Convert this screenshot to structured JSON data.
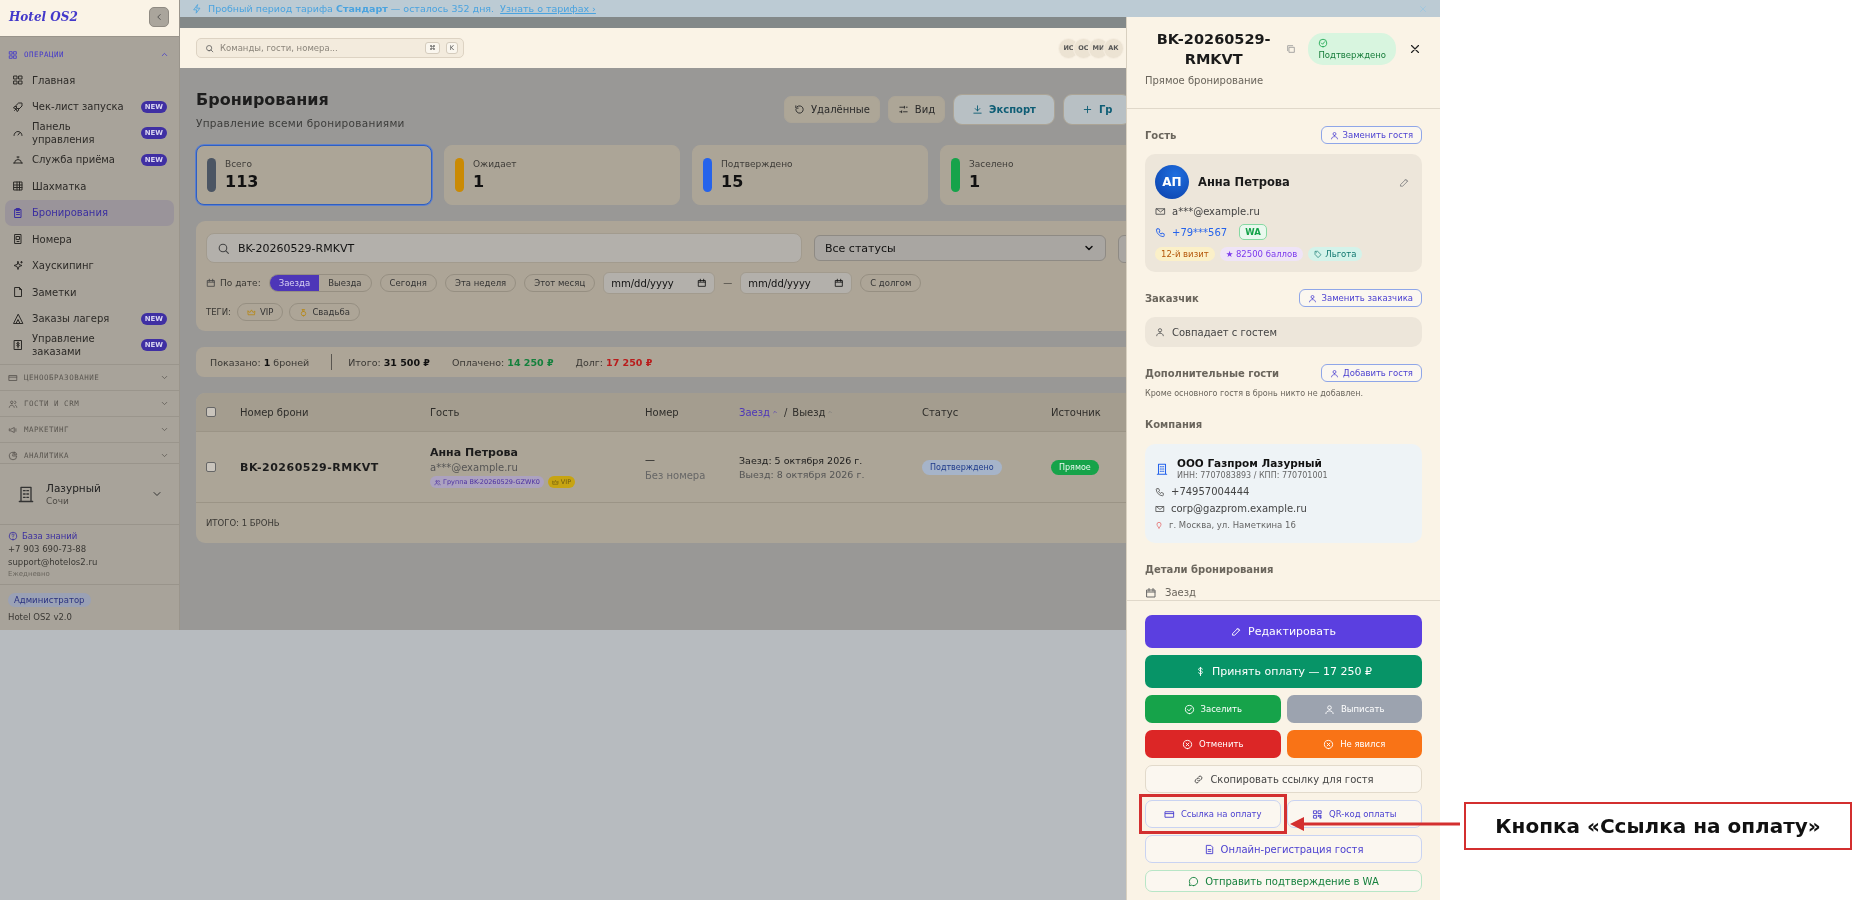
{
  "banner": {
    "text": "Пробный период тарифа **Стандарт** — осталось 352 дня.",
    "link": "Узнать о тарифах ›"
  },
  "sidebar": {
    "logo": "Hotel OS2",
    "sections": [
      {
        "title": "ОПЕРАЦИИ",
        "expanded": true,
        "items": [
          {
            "label": "Главная",
            "selected": false
          },
          {
            "label": "Чек-лист запуска",
            "badge": "NEW",
            "selected": false
          },
          {
            "label": "Панель управления",
            "badge": "NEW",
            "selected": false
          },
          {
            "label": "Служба приёма",
            "badge": "NEW",
            "selected": false
          },
          {
            "label": "Шахматка",
            "selected": false
          },
          {
            "label": "Бронирования",
            "selected": true
          },
          {
            "label": "Номера",
            "selected": false
          },
          {
            "label": "Хаускипинг",
            "selected": false
          },
          {
            "label": "Заметки",
            "selected": false
          },
          {
            "label": "Заказы лагеря",
            "badge": "NEW",
            "selected": false
          },
          {
            "label": "Управление заказами",
            "badge": "NEW",
            "selected": false
          }
        ]
      },
      {
        "title": "ЦЕНООБРАЗОВАНИЕ",
        "expanded": false
      },
      {
        "title": "ГОСТИ И CRM",
        "expanded": false
      },
      {
        "title": "МАРКЕТИНГ",
        "expanded": false
      },
      {
        "title": "АНАЛИТИКА",
        "expanded": false
      }
    ],
    "hotel": {
      "name": "Лазурный",
      "city": "Сочи"
    },
    "support": {
      "link": "База знаний",
      "phone": "+7 903 690-73-88",
      "email": "support@hotelos2.ru",
      "hours": "Ежедневно"
    },
    "user": {
      "role": "Администратор",
      "version": "Hotel OS2 v2.0"
    }
  },
  "topbar": {
    "search_placeholder": "Команды, гости, номера...",
    "shortcut": [
      "⌘",
      "K"
    ],
    "avatars": [
      "ИС",
      "ОС",
      "МИ",
      "АК"
    ]
  },
  "page": {
    "title": "Бронирования",
    "subtitle": "Управление всеми бронированиями",
    "actions": [
      {
        "label": "Удалённые",
        "kind": "restore"
      },
      {
        "label": "Вид",
        "kind": "view"
      },
      {
        "label": "Экспорт",
        "kind": "export"
      },
      {
        "label": "Гр",
        "kind": "create"
      }
    ]
  },
  "stats": [
    {
      "label": "Всего",
      "value": "113",
      "color": "#4b5563",
      "selected": true
    },
    {
      "label": "Ожидает",
      "value": "1",
      "color": "#ca8a04",
      "selected": false
    },
    {
      "label": "Подтверждено",
      "value": "15",
      "color": "#2563eb",
      "selected": false
    },
    {
      "label": "Заселено",
      "value": "1",
      "color": "#16a34a",
      "selected": false
    }
  ],
  "filters": {
    "search": "BK-20260529-RMKVT",
    "status": "Все статусы",
    "date_label": "По дате:",
    "date_modes": [
      {
        "label": "Заезда",
        "selected": true
      },
      {
        "label": "Выезда",
        "selected": false
      }
    ],
    "presets": [
      "Сегодня",
      "Эта неделя",
      "Этот месяц"
    ],
    "date_from": "mm/dd/yyyy",
    "range_separator": "—",
    "date_to": "mm/dd/yyyy",
    "debt": "С долгом",
    "tags_label": "ТЕГИ:",
    "tags": [
      {
        "label": "VIP",
        "kind": "vip"
      },
      {
        "label": "Свадьба",
        "kind": "wedding"
      }
    ]
  },
  "summary": [
    {
      "text": "Показано: **1** броней",
      "kind": "shown"
    },
    {
      "text": "Итого: **31 500 ₽**",
      "kind": "total"
    },
    {
      "text": "Оплачено: **14 250 ₽**",
      "kind": "paid"
    },
    {
      "text": "Долг: **17 250 ₽**",
      "kind": "debt"
    }
  ],
  "table": {
    "select_all_checked": false,
    "columns": [
      {
        "label": "Номер брони"
      },
      {
        "label": "Гость"
      },
      {
        "label": "Номер"
      },
      {
        "kind": "sort_pair",
        "separator": "/",
        "parts": [
          {
            "label": "Заезд",
            "selected": true
          },
          {
            "label": "Выезд",
            "selected": false
          }
        ]
      },
      {
        "label": "Статус"
      },
      {
        "label": "Источник"
      }
    ],
    "rows": [
      {
        "checked": false,
        "number": "BK-20260529-RMKVT",
        "guest": "Анна Петрова",
        "email": "a***@example.ru",
        "tags": [
          {
            "label": "Группа BK-20260529-GZWK0",
            "kind": "group"
          },
          {
            "label": "VIP",
            "kind": "vip"
          }
        ],
        "room": "—",
        "room_note": "Без номера",
        "checkin": "Заезд: 5 октября 2026 г.",
        "checkout": "Выезд: 8 октября 2026 г.",
        "status": "Подтверждено",
        "source": "Прямое"
      }
    ],
    "footer": "ИТОГО: 1 БРОНЬ"
  },
  "drawer": {
    "title": "BK-20260529-RMKVT",
    "status": "Подтверждено",
    "subtitle": "Прямое бронирование",
    "guest_section": {
      "title": "Гость",
      "action": "Заменить гостя"
    },
    "guest": {
      "initials": "АП",
      "name": "Анна Петрова",
      "email": "a***@example.ru",
      "phone": "+79***567",
      "messenger": "WA",
      "tags": [
        {
          "label": "12-й визит",
          "kind": "visits"
        },
        {
          "label": "★ 82500 баллов",
          "kind": "points"
        },
        {
          "label": "Льгота",
          "kind": "benefit"
        }
      ]
    },
    "customer_section": {
      "title": "Заказчик",
      "action": "Заменить заказчика",
      "value": "Совпадает с гостем"
    },
    "extra_section": {
      "title": "Дополнительные гости",
      "action": "Добавить гостя",
      "note": "Кроме основного гостя в бронь никто не добавлен."
    },
    "company_section": {
      "title": "Компания",
      "name": "ООО Газпром Лазурный",
      "ids": "ИНН: 7707083893 / КПП: 770701001",
      "phone": "+74957004444",
      "email": "corp@gazprom.example.ru",
      "address": "г. Москва, ул. Наметкина 16"
    },
    "details_section": {
      "title": "Детали бронирования",
      "first_label": "Заезд"
    },
    "actions": [
      {
        "label": "Редактировать",
        "kind": "edit",
        "highlighted": false
      },
      {
        "label": "Принять оплату — 17 250 ₽",
        "kind": "pay",
        "highlighted": false
      },
      {
        "label": "Заселить",
        "kind": "checkin",
        "highlighted": false
      },
      {
        "label": "Выписать",
        "kind": "checkout",
        "highlighted": false
      },
      {
        "label": "Отменить",
        "kind": "cancel",
        "highlighted": false
      },
      {
        "label": "Не явился",
        "kind": "noshow",
        "highlighted": false
      },
      {
        "label": "Скопировать ссылку для гостя",
        "kind": "copylink",
        "highlighted": false
      },
      {
        "label": "Ссылка на оплату",
        "kind": "paylink",
        "highlighted": true
      },
      {
        "label": "QR-код оплаты",
        "kind": "qr",
        "highlighted": false
      },
      {
        "label": "Онлайн-регистрация гостя",
        "kind": "register",
        "highlighted": false
      },
      {
        "label": "Отправить подтверждение в WA",
        "kind": "whatsapp",
        "highlighted": false
      }
    ]
  },
  "annotation": {
    "text": "Кнопка «Ссылка на оплату»"
  }
}
